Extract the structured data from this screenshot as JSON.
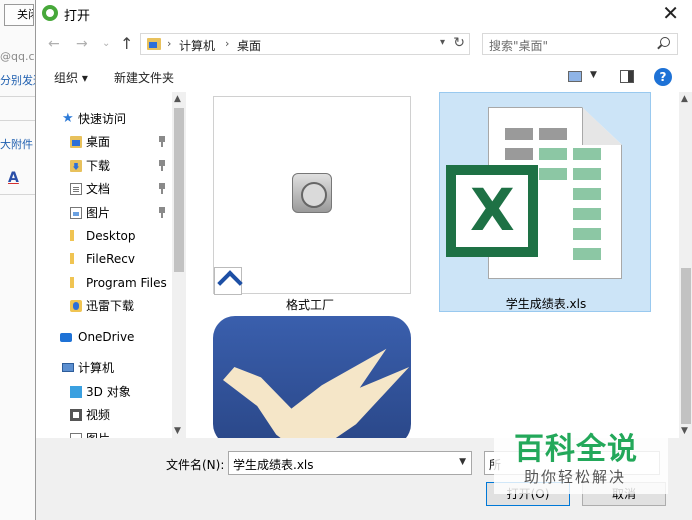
{
  "background_app": {
    "close_button": "关闭",
    "lines": [
      "@qq.c",
      "分别发送",
      "大附件"
    ]
  },
  "dialog": {
    "title": "打开",
    "address": {
      "segments": [
        "计算机",
        "桌面"
      ]
    },
    "search": {
      "placeholder": "搜索\"桌面\""
    },
    "toolbar": {
      "organize": "组织 ▾",
      "new_folder": "新建文件夹"
    },
    "nav_items": [
      {
        "label": "快速访问",
        "icon": "star-icon"
      },
      {
        "label": "桌面",
        "icon": "desktop-folder-icon",
        "pinned": true
      },
      {
        "label": "下载",
        "icon": "download-folder-icon",
        "pinned": true
      },
      {
        "label": "文档",
        "icon": "document-icon",
        "pinned": true
      },
      {
        "label": "图片",
        "icon": "picture-icon",
        "pinned": true
      },
      {
        "label": "Desktop",
        "icon": "folder-icon"
      },
      {
        "label": "FileRecv",
        "icon": "folder-icon"
      },
      {
        "label": "Program Files",
        "icon": "folder-icon"
      },
      {
        "label": "迅雷下载",
        "icon": "thunder-folder-icon"
      },
      {
        "label": "OneDrive",
        "icon": "onedrive-icon"
      },
      {
        "label": "计算机",
        "icon": "computer-icon"
      },
      {
        "label": "3D 对象",
        "icon": "3d-objects-icon"
      },
      {
        "label": "视频",
        "icon": "video-icon"
      },
      {
        "label": "图片",
        "icon": "picture-icon"
      }
    ],
    "files": [
      {
        "name": "格式工厂",
        "icon": "format-factory-icon",
        "shortcut": true
      },
      {
        "name": "学生成绩表.xls",
        "icon": "excel-file-icon",
        "selected": true
      },
      {
        "name": "",
        "icon": "thunder-bird-icon"
      }
    ],
    "footer": {
      "filename_label": "文件名(N):",
      "filename_value": "学生成绩表.xls",
      "filetype_value": "所",
      "open_button": "打开(O)",
      "cancel_button": "取消"
    }
  },
  "watermark": {
    "title": "百科全说",
    "subtitle": "助你轻松解决"
  },
  "colors": {
    "selection": "#cce4f7",
    "excel_green": "#1e7145",
    "accent": "#0078d7"
  }
}
